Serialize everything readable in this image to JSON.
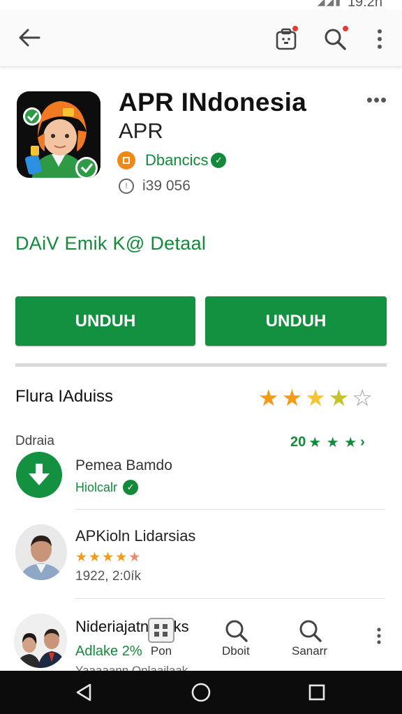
{
  "status_bar": {
    "time": "19:2n",
    "icons": "◢◢▮"
  },
  "app_bar": {
    "back_icon": "arrow-left-icon",
    "icons": [
      "gift-notification-icon",
      "search-icon",
      "more-vert-icon"
    ]
  },
  "app": {
    "title": "APR INdonesia",
    "developer": "APR",
    "badge_label": "Dbancics",
    "size": "i39 056",
    "more_label": "•••"
  },
  "details_link": "DAiV Emik K@ Detaal",
  "buttons": {
    "primary": "UNDUH",
    "secondary": "UNDUH"
  },
  "ratings": {
    "section_title": "Flura IAduiss",
    "stars": [
      {
        "icon": "star-filled-icon",
        "glyph": "★",
        "color": "#f29b18"
      },
      {
        "icon": "star-filled-icon",
        "glyph": "★",
        "color": "#f29b18"
      },
      {
        "icon": "star-filled-icon",
        "glyph": "★",
        "color": "#f6c431"
      },
      {
        "icon": "star-filled-icon",
        "glyph": "★",
        "color": "#c6c22a"
      },
      {
        "icon": "star-empty-icon",
        "glyph": "☆",
        "color": "#9e9e9e"
      }
    ],
    "review_label": "Ddraia",
    "review_count": "20",
    "review_stars_glyph": "★ ★ ★",
    "review_suffix": "›"
  },
  "items": [
    {
      "title": "Pemea Bamdo",
      "subtitle": "Hiolcalr"
    },
    {
      "title": "APKioln Lidarsias",
      "rating": 4.5,
      "meta": "1922, 2:0ík"
    },
    {
      "title": "Nideriajatn  biaks",
      "subtitle": "Adlake 2%",
      "footer": "Yaaaaann Onlaailaak"
    }
  ],
  "bottom_nav": [
    {
      "label": "Pon",
      "icon": "apps-grid-icon"
    },
    {
      "label": "Dboit",
      "icon": "search-icon"
    },
    {
      "label": "Sanarr",
      "icon": "search-icon"
    }
  ],
  "colors": {
    "brand_green": "#149140",
    "text_green": "#128a3a",
    "badge_orange": "#ee8a14"
  }
}
